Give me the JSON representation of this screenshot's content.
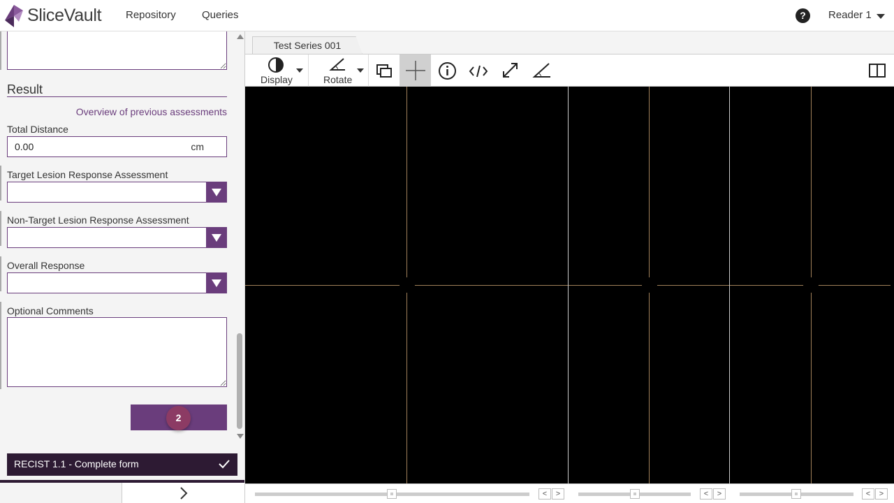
{
  "app": {
    "name": "SliceVault",
    "brand_color": "#6a3d7c"
  },
  "nav": {
    "items": [
      {
        "label": "Repository"
      },
      {
        "label": "Queries"
      }
    ],
    "help_glyph": "?",
    "user": "Reader 1"
  },
  "form": {
    "section_title": "Result",
    "overview_link": "Overview of previous assessments",
    "total_distance": {
      "label": "Total Distance",
      "value": "0.00",
      "unit": "cm"
    },
    "target_lesion": {
      "label": "Target Lesion Response Assessment",
      "value": ""
    },
    "non_target_lesion": {
      "label": "Non-Target Lesion Response Assessment",
      "value": ""
    },
    "overall_response": {
      "label": "Overall Response",
      "value": ""
    },
    "comments": {
      "label": "Optional Comments",
      "value": ""
    },
    "submit_badge": "2",
    "status_bar": "RECIST 1.1 - Complete form"
  },
  "viewer": {
    "tab_label": "Test Series 001",
    "tools": {
      "display_label": "Display",
      "rotate_label": "Rotate"
    },
    "crosshair_color": "#a0805a"
  }
}
